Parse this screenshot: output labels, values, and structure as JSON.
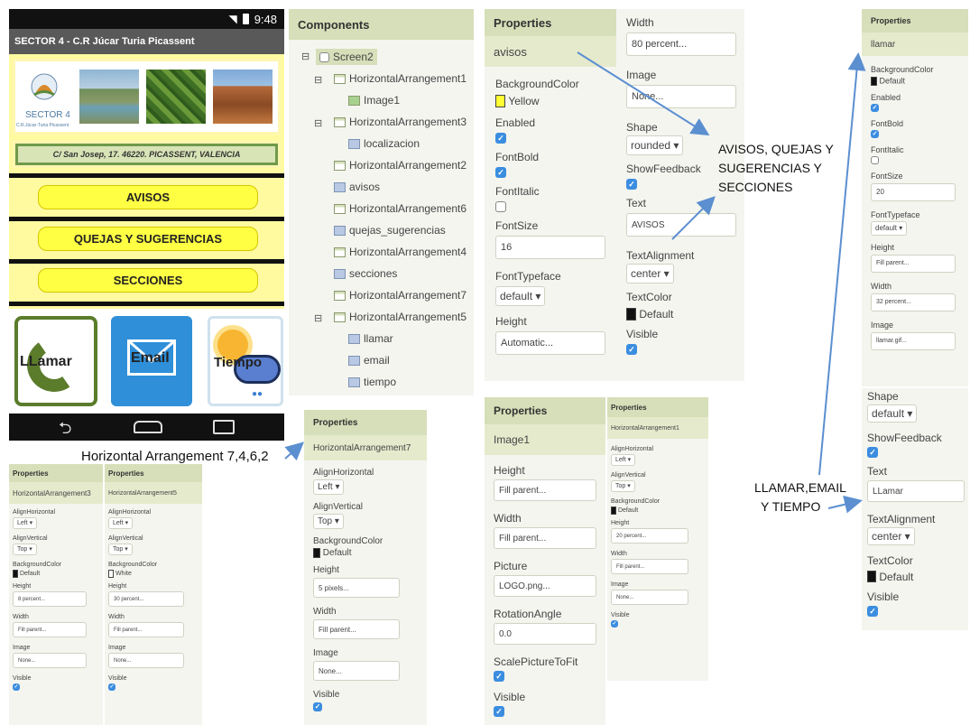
{
  "phone": {
    "status_time": "9:48",
    "app_title": "SECTOR 4 - C.R Júcar Turia Picassent",
    "logo_text": "SECTOR 4",
    "logo_subtext": "C.R.Júcar-Turia Picassent",
    "address": "C/ San Josep, 17. 46220. PICASSENT, VALENCIA",
    "buttons": [
      "AVISOS",
      "QUEJAS Y SUGERENCIAS",
      "SECCIONES"
    ],
    "icon_buttons": [
      "LLamar",
      "Email",
      "Tiempo"
    ]
  },
  "components": {
    "header": "Components",
    "items": [
      "Screen2",
      "HorizontalArrangement1",
      "Image1",
      "HorizontalArrangement3",
      "localizacion",
      "HorizontalArrangement2",
      "avisos",
      "HorizontalArrangement6",
      "quejas_sugerencias",
      "HorizontalArrangement4",
      "secciones",
      "HorizontalArrangement7",
      "HorizontalArrangement5",
      "llamar",
      "email",
      "tiempo"
    ]
  },
  "avisos_props": {
    "header": "Properties",
    "component": "avisos",
    "labels": [
      "BackgroundColor",
      "Enabled",
      "FontBold",
      "FontItalic",
      "FontSize",
      "FontTypeface",
      "Height",
      "Width",
      "Image",
      "Shape",
      "ShowFeedback",
      "Text",
      "TextAlignment",
      "TextColor",
      "Visible"
    ],
    "bg_value": "Yellow",
    "bg_color": "#ffff33",
    "fontsize": "16",
    "typeface": "default ▾",
    "height": "Automatic...",
    "width": "80 percent...",
    "image": "None...",
    "shape": "rounded ▾",
    "text": "AVISOS",
    "align": "center ▾",
    "textcolor": "Default"
  },
  "llamar_props": {
    "header": "Properties",
    "component": "llamar",
    "labels": [
      "BackgroundColor",
      "Enabled",
      "FontBold",
      "FontItalic",
      "FontSize",
      "FontTypeface",
      "Height",
      "Width",
      "Image",
      "Shape",
      "ShowFeedback",
      "Text",
      "TextAlignment",
      "TextColor",
      "Visible"
    ],
    "bg_value": "Default",
    "fontsize": "20",
    "typeface": "default ▾",
    "height": "Fill parent...",
    "width": "32 percent...",
    "image": "llamar.gif...",
    "shape": "default ▾",
    "text": "LLamar",
    "align": "center ▾",
    "textcolor": "Default"
  },
  "ha7_props": {
    "header": "Properties",
    "component": "HorizontalArrangement7",
    "labels": [
      "AlignHorizontal",
      "AlignVertical",
      "BackgroundColor",
      "Height",
      "Width",
      "Image",
      "Visible"
    ],
    "alignh": "Left ▾",
    "alignv": "Top ▾",
    "bg": "Default",
    "height": "5 pixels...",
    "width": "Fill parent...",
    "image": "None..."
  },
  "ha3_props": {
    "header": "Properties",
    "component": "HorizontalArrangement3",
    "labels": [
      "AlignHorizontal",
      "AlignVertical",
      "BackgroundColor",
      "Height",
      "Width",
      "Image",
      "Visible"
    ],
    "alignh": "Left ▾",
    "alignv": "Top ▾",
    "bg": "Default",
    "height": "8 percent...",
    "width": "Fill parent...",
    "image": "None..."
  },
  "ha5_props": {
    "header": "Properties",
    "component": "HorizontalArrangement5",
    "labels": [
      "AlignHorizontal",
      "AlignVertical",
      "BackgroundColor",
      "Height",
      "Width",
      "Image",
      "Visible"
    ],
    "alignh": "Left ▾",
    "alignv": "Top ▾",
    "bg": "White",
    "height": "30 percent...",
    "width": "Fill parent...",
    "image": "None..."
  },
  "image1_props": {
    "header": "Properties",
    "component": "Image1",
    "labels": [
      "Height",
      "Width",
      "Picture",
      "RotationAngle",
      "ScalePictureToFit",
      "Visible"
    ],
    "height": "Fill parent...",
    "width": "Fill parent...",
    "picture": "LOGO.png...",
    "rotation": "0.0"
  },
  "ha1_props": {
    "header": "Properties",
    "component": "HorizontalArrangement1",
    "labels": [
      "AlignHorizontal",
      "AlignVertical",
      "BackgroundColor",
      "Height",
      "Width",
      "Image",
      "Visible"
    ],
    "alignh": "Left ▾",
    "alignv": "Top ▾",
    "bg": "Default",
    "height": "20 percent...",
    "width": "Fill parent...",
    "image": "None..."
  },
  "annotations": {
    "ha": "Horizontal Arrangement 7,4,6,2",
    "avisos_l1": "AVISOS, QUEJAS Y",
    "avisos_l2": "SUGERENCIAS Y",
    "avisos_l3": "SECCIONES",
    "llamar_l1": "LLAMAR,EMAIL",
    "llamar_l2": "Y TIEMPO"
  }
}
